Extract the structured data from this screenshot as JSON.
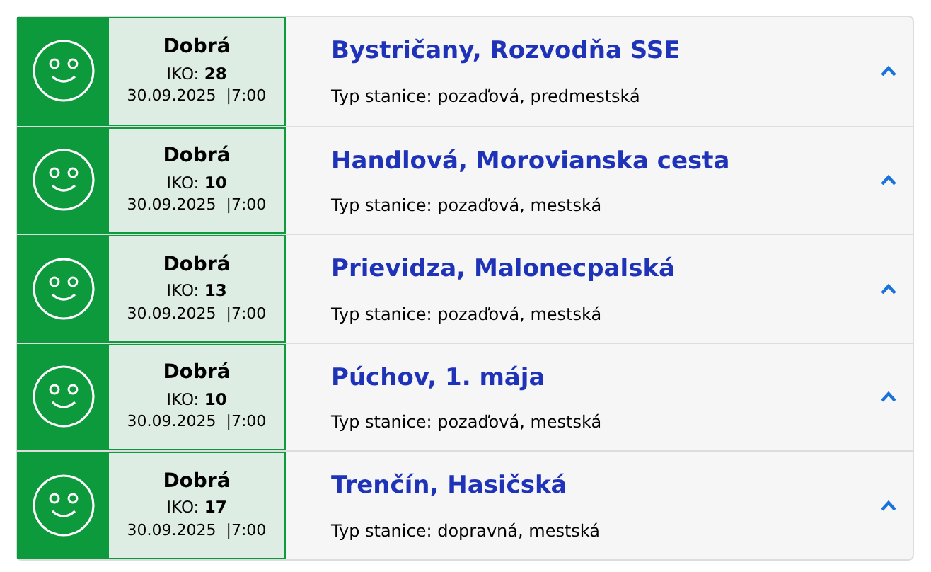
{
  "stations": [
    {
      "quality": "Dobrá",
      "iko": "IKO: **28**",
      "date": "30.09.2025",
      "time": "|7:00",
      "name": "Bystričany, Rozvodňa SSE",
      "type": "Typ stanice: pozaďová, predmestská",
      "expanded": true
    },
    {
      "quality": "Dobrá",
      "iko": "IKO: **10**",
      "date": "30.09.2025",
      "time": "|7:00",
      "name": "Handlová, Morovianska cesta",
      "type": "Typ stanice: pozaďová, mestská",
      "expanded": true
    },
    {
      "quality": "Dobrá",
      "iko": "IKO: **13**",
      "date": "30.09.2025",
      "time": "|7:00",
      "name": "Prievidza, Malonecpalská",
      "type": "Typ stanice: pozaďová, mestská",
      "expanded": true
    },
    {
      "quality": "Dobrá",
      "iko": "IKO: **10**",
      "date": "30.09.2025",
      "time": "|7:00",
      "name": "Púchov, 1. mája",
      "type": "Typ stanice: pozaďová, mestská",
      "expanded": true
    },
    {
      "quality": "Dobrá",
      "iko": "IKO: **17**",
      "date": "30.09.2025",
      "time": "|7:00",
      "name": "Trenčín, Hasičská",
      "type": "Typ stanice: dopravná, mestská",
      "expanded": true
    }
  ]
}
